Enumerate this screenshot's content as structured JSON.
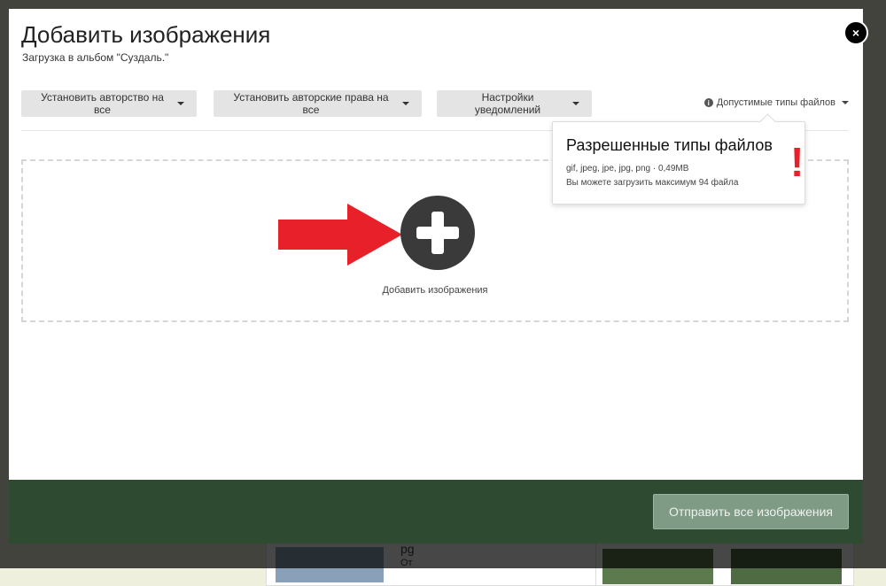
{
  "modal": {
    "title": "Добавить изображения",
    "subtitle": "Загрузка в альбом \"Суздаль.\"",
    "close_label": "×"
  },
  "toolbar": {
    "authorship_label": "Установить авторство на все",
    "copyright_label": "Установить авторские права на все",
    "notifications_label": "Настройки уведомлений",
    "filetypes_label": "Допустимые типы файлов"
  },
  "dropzone": {
    "label": "Добавить изображения"
  },
  "popover": {
    "title": "Разрешенные типы файлов",
    "types": "gif, jpeg, jpe, jpg, png · 0,49MB",
    "limit": "Вы можете загрузить максимум 94 файла",
    "exclamation": "!"
  },
  "footer": {
    "submit_label": "Отправить все изображения"
  },
  "background": {
    "partial_text_1": "pg",
    "partial_text_2": "От"
  },
  "colors": {
    "footer_bg": "#2e4a30",
    "submit_bg": "#7f9b85",
    "annotation_red": "#e8202a"
  }
}
